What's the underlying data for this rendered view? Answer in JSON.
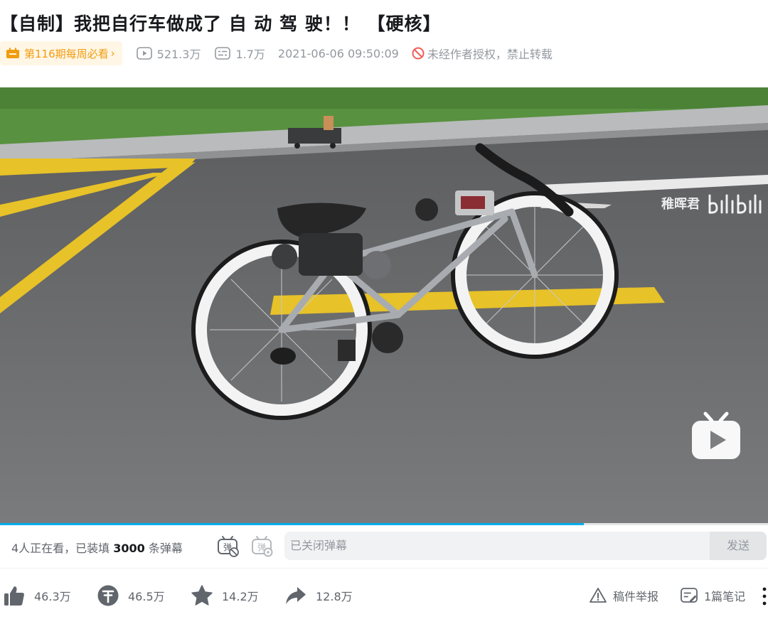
{
  "video": {
    "title": "【自制】我把自行车做成了 自 动 驾 驶！！ 【硬核】",
    "weekly_badge": "第116期每周必看",
    "weekly_arrow": "›",
    "views": "521.3万",
    "danmaku_count": "1.7万",
    "publish_time": "2021-06-06 09:50:09",
    "copyright_notice": "未经作者授权，禁止转载",
    "watermark_uploader": "稚晖君",
    "progress_fraction": 0.76
  },
  "danmaku_bar": {
    "viewers_prefix": "4人正在看，已装填",
    "viewers_count": "3000",
    "viewers_suffix": "条弹幕",
    "input_placeholder": "已关闭弹幕",
    "send_label": "发送"
  },
  "toolbar": {
    "like_count": "46.3万",
    "coin_count": "46.5万",
    "favorite_count": "14.2万",
    "share_count": "12.8万",
    "report_label": "稿件举报",
    "notes_label": "1篇笔记"
  },
  "colors": {
    "accent_blue": "#00aeec",
    "badge_orange": "#f19c0e",
    "muted_gray": "#9499a0"
  },
  "icons": [
    "weekly-badge-icon",
    "play-count-icon",
    "danmaku-count-icon",
    "no-repost-icon",
    "bilibili-logo-icon",
    "play-overlay-icon",
    "danmaku-toggle-icon",
    "danmaku-settings-icon",
    "like-icon",
    "coin-icon",
    "favorite-icon",
    "share-icon",
    "report-icon",
    "notes-icon",
    "more-icon"
  ]
}
